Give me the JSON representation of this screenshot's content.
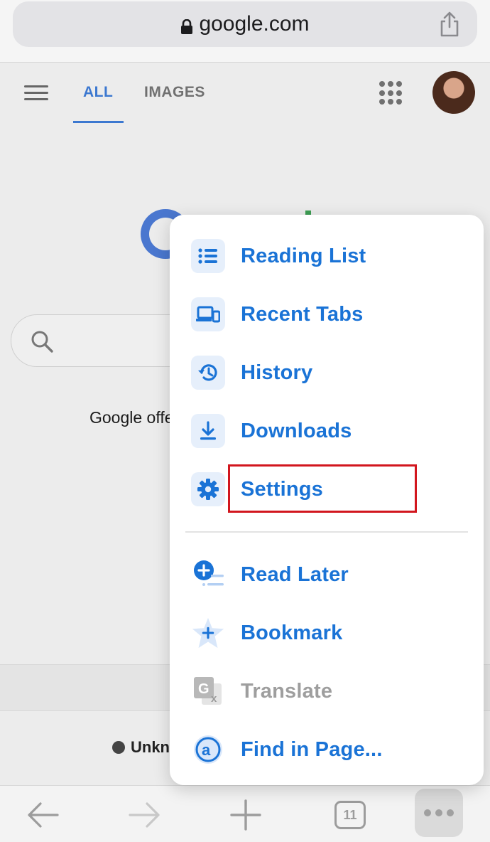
{
  "address_bar": {
    "url": "google.com"
  },
  "google_page": {
    "tabs": [
      {
        "label": "ALL"
      },
      {
        "label": "IMAGES"
      }
    ],
    "offered_text": "Google offe",
    "location_text": "Unkn"
  },
  "menu": {
    "items": [
      {
        "label": "Reading List",
        "icon": "reading-list-icon"
      },
      {
        "label": "Recent Tabs",
        "icon": "recent-tabs-icon"
      },
      {
        "label": "History",
        "icon": "history-icon"
      },
      {
        "label": "Downloads",
        "icon": "downloads-icon"
      },
      {
        "label": "Settings",
        "icon": "settings-icon"
      },
      {
        "label": "Read Later",
        "icon": "read-later-icon"
      },
      {
        "label": "Bookmark",
        "icon": "bookmark-icon"
      },
      {
        "label": "Translate",
        "icon": "translate-icon",
        "disabled": true
      },
      {
        "label": "Find in Page...",
        "icon": "find-in-page-icon"
      }
    ]
  },
  "toolbar": {
    "tab_count": "11"
  },
  "colors": {
    "accent": "#1a73d6",
    "highlight_box": "#d2161e"
  }
}
